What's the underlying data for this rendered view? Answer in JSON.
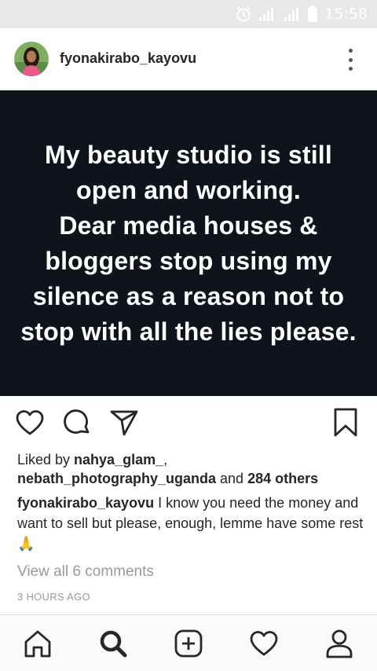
{
  "status_bar": {
    "time": "15:58",
    "icons": [
      "alarm-icon",
      "signal-icon",
      "signal-3g-icon",
      "battery-icon"
    ]
  },
  "post": {
    "username": "fyonakirabo_kayovu",
    "image_text": "My beauty studio is still\nopen and working.\nDear media houses &\nbloggers stop using my\nsilence as a reason not to\nstop with all the lies please.",
    "likes": {
      "prefix": "Liked by ",
      "user1": "nahya_glam_",
      "comma": ",",
      "user2": "nebath_photography_uganda",
      "and": " and ",
      "others": "284 others"
    },
    "caption": {
      "username": "fyonakirabo_kayovu",
      "text": " I know you need the money and want to sell but please, enough, lemme have some rest ",
      "emoji": "🙏"
    },
    "view_comments": "View all 6 comments",
    "time_ago": "3 HOURS AGO"
  },
  "icons": {
    "header": [
      "avatar",
      "more-options-icon"
    ],
    "actions": [
      "heart-icon",
      "comment-icon",
      "share-icon",
      "bookmark-icon"
    ],
    "bottom_nav": [
      "home-icon",
      "search-icon",
      "add-post-icon",
      "activity-heart-icon",
      "profile-icon"
    ]
  }
}
